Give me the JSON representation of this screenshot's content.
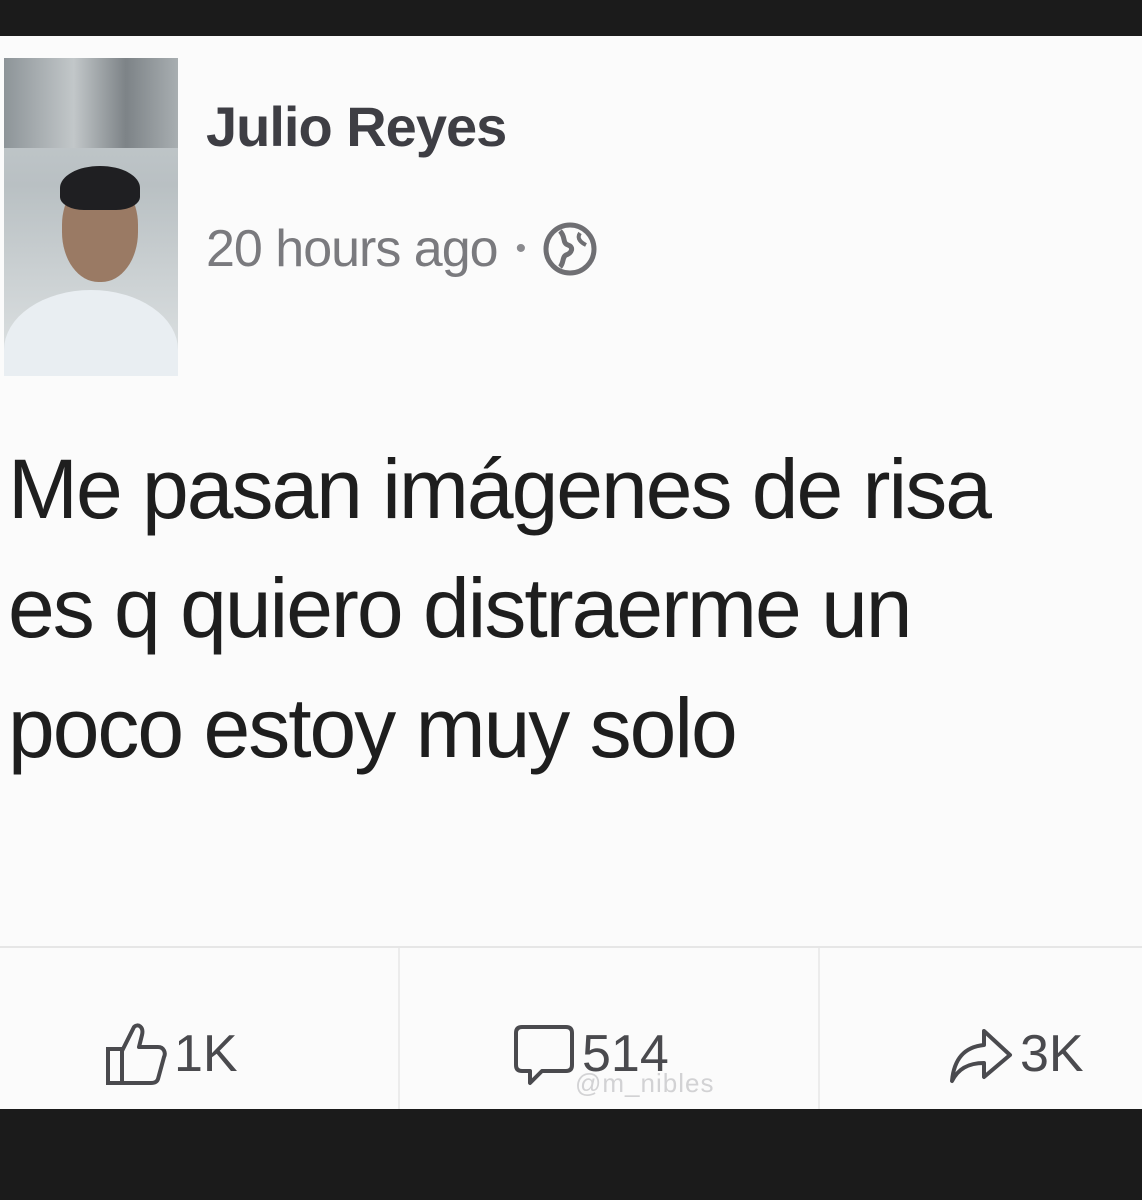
{
  "post": {
    "author_name": "Julio Reyes",
    "timestamp": "20 hours ago",
    "separator": "•",
    "privacy_icon": "globe-icon",
    "text_lines": [
      "Me pasan imágenes de risa",
      "es q quiero distraerme un",
      "poco estoy muy solo"
    ]
  },
  "actions": {
    "like": {
      "icon": "thumbs-up-icon",
      "count": "1K"
    },
    "comment": {
      "icon": "comment-icon",
      "count": "514"
    },
    "share": {
      "icon": "share-icon",
      "count": "3K"
    }
  },
  "watermark": "@m_nibles",
  "colors": {
    "background": "#fbfbfb",
    "frame": "#1b1b1b",
    "text": "#1e1e1e",
    "muted": "#7a7a7e"
  }
}
